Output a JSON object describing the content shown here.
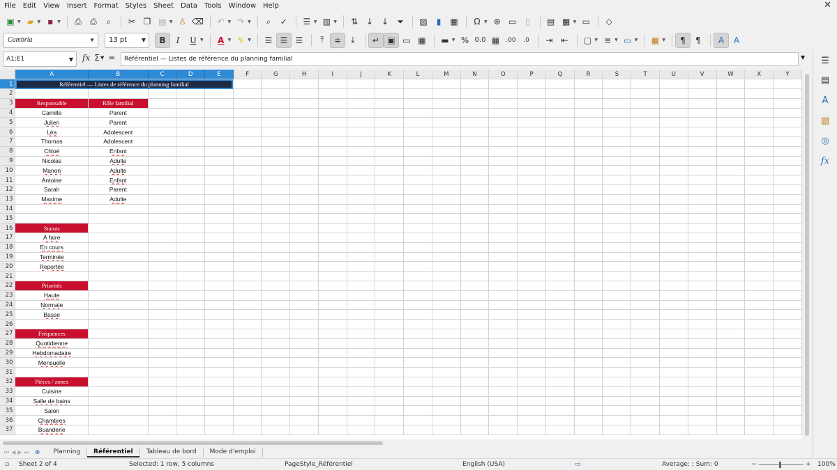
{
  "menubar": {
    "items": [
      "File",
      "Edit",
      "View",
      "Insert",
      "Format",
      "Styles",
      "Sheet",
      "Data",
      "Tools",
      "Window",
      "Help"
    ]
  },
  "toolbar2": {
    "font_name": "Cambria",
    "font_size": "13 pt",
    "bold": "B",
    "italic": "I",
    "underline": "U"
  },
  "formulabar": {
    "name_box": "A1:E1",
    "formula": "Référentiel — Listes de référence du planning familial"
  },
  "columns": [
    "A",
    "B",
    "C",
    "D",
    "E",
    "F",
    "G",
    "H",
    "I",
    "J",
    "K",
    "L",
    "M",
    "N",
    "O",
    "P",
    "Q",
    "R",
    "S",
    "T",
    "U",
    "V",
    "W",
    "X",
    "Y"
  ],
  "rows": [
    {
      "n": "1",
      "a": "Référentiel — Listes de référence du planning familial",
      "b": "",
      "t": "title"
    },
    {
      "n": "2",
      "a": "",
      "b": "",
      "t": ""
    },
    {
      "n": "3",
      "a": "Responsable",
      "b": "Rôle familial",
      "t": "hdr2"
    },
    {
      "n": "4",
      "a": "Camille",
      "b": "Parent",
      "t": ""
    },
    {
      "n": "5",
      "a": "Julien",
      "b": "Parent",
      "t": "ua"
    },
    {
      "n": "6",
      "a": "Léa",
      "b": "Adolescent",
      "t": "ua"
    },
    {
      "n": "7",
      "a": "Thomas",
      "b": "Adolescent",
      "t": ""
    },
    {
      "n": "8",
      "a": "Chloé",
      "b": "Enfant",
      "t": "uab"
    },
    {
      "n": "9",
      "a": "Nicolas",
      "b": "Adulte",
      "t": "ub"
    },
    {
      "n": "10",
      "a": "Manon",
      "b": "Adulte",
      "t": "uab"
    },
    {
      "n": "11",
      "a": "Antoine",
      "b": "Enfant",
      "t": "ub"
    },
    {
      "n": "12",
      "a": "Sarah",
      "b": "Parent",
      "t": ""
    },
    {
      "n": "13",
      "a": "Maxime",
      "b": "Adulte",
      "t": "uab"
    },
    {
      "n": "14",
      "a": "",
      "b": "",
      "t": ""
    },
    {
      "n": "15",
      "a": "",
      "b": "",
      "t": ""
    },
    {
      "n": "16",
      "a": "Statuts",
      "b": "",
      "t": "hdr1"
    },
    {
      "n": "17",
      "a": "À faire",
      "b": "",
      "t": "ua"
    },
    {
      "n": "18",
      "a": "En cours",
      "b": "",
      "t": "ua"
    },
    {
      "n": "19",
      "a": "Terminée",
      "b": "",
      "t": "ua"
    },
    {
      "n": "20",
      "a": "Reportée",
      "b": "",
      "t": "ua"
    },
    {
      "n": "21",
      "a": "",
      "b": "",
      "t": ""
    },
    {
      "n": "22",
      "a": "Priorités",
      "b": "",
      "t": "hdr1"
    },
    {
      "n": "23",
      "a": "Haute",
      "b": "",
      "t": "ua"
    },
    {
      "n": "24",
      "a": "Normale",
      "b": "",
      "t": "ua"
    },
    {
      "n": "25",
      "a": "Basse",
      "b": "",
      "t": "ua"
    },
    {
      "n": "26",
      "a": "",
      "b": "",
      "t": ""
    },
    {
      "n": "27",
      "a": "Fréquences",
      "b": "",
      "t": "hdr1"
    },
    {
      "n": "28",
      "a": "Quotidienne",
      "b": "",
      "t": "ua"
    },
    {
      "n": "29",
      "a": "Hebdomadaire",
      "b": "",
      "t": "ua"
    },
    {
      "n": "30",
      "a": "Mensuelle",
      "b": "",
      "t": "ua"
    },
    {
      "n": "31",
      "a": "",
      "b": "",
      "t": ""
    },
    {
      "n": "32",
      "a": "Pièces / zones",
      "b": "",
      "t": "hdr1"
    },
    {
      "n": "33",
      "a": "Cuisine",
      "b": "",
      "t": ""
    },
    {
      "n": "34",
      "a": "Salle de bains",
      "b": "",
      "t": "ua"
    },
    {
      "n": "35",
      "a": "Salon",
      "b": "",
      "t": ""
    },
    {
      "n": "36",
      "a": "Chambres",
      "b": "",
      "t": "ua"
    },
    {
      "n": "37",
      "a": "Buanderie",
      "b": "",
      "t": "ua"
    }
  ],
  "tabs": [
    "Planning",
    "Référentiel",
    "Tableau de bord",
    "Mode d'emploi"
  ],
  "active_tab": "Référentiel",
  "statusbar": {
    "sheet": "Sheet 2 of 4",
    "selection": "Selected: 1 row, 5 columns",
    "page_style": "PageStyle_Référentiel",
    "language": "English (USA)",
    "summary": "Average: ; Sum: 0",
    "zoom": "100%"
  },
  "colors": {
    "header_red": "#c8102e",
    "title_navy": "#1f2a44",
    "selection_blue": "#2e8ad6"
  }
}
